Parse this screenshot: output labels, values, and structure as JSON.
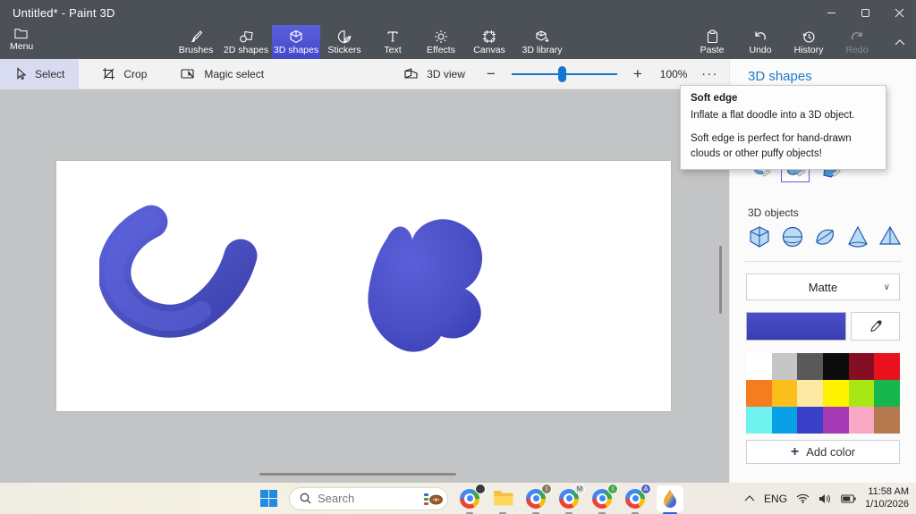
{
  "window": {
    "title": "Untitled* - Paint 3D"
  },
  "ribbon": {
    "menu_label": "Menu",
    "tabs": [
      {
        "label": "Brushes"
      },
      {
        "label": "2D shapes"
      },
      {
        "label": "3D shapes",
        "active": true
      },
      {
        "label": "Stickers"
      },
      {
        "label": "Text"
      },
      {
        "label": "Effects"
      },
      {
        "label": "Canvas"
      },
      {
        "label": "3D library"
      }
    ],
    "actions": [
      {
        "label": "Paste"
      },
      {
        "label": "Undo"
      },
      {
        "label": "History"
      },
      {
        "label": "Redo",
        "disabled": true
      }
    ]
  },
  "toolbar": {
    "select_label": "Select",
    "crop_label": "Crop",
    "magic_select_label": "Magic select",
    "view3d_label": "3D view",
    "zoom_value": "100%",
    "more_label": "..."
  },
  "panel": {
    "title": "3D shapes",
    "objects_label": "3D objects",
    "material_value": "Matte",
    "add_color_label": "Add color",
    "add_color_plus": "+",
    "current_color": "#4b4fc9",
    "current_color_dark": "#3a3db0",
    "palette": [
      "#ffffff",
      "#c6c6c6",
      "#595959",
      "#0c0c0c",
      "#850e22",
      "#e8121d",
      "#f57d20",
      "#fcbe1c",
      "#fce9a4",
      "#fef200",
      "#a8e616",
      "#17b54d",
      "#70f3ee",
      "#0aa0e8",
      "#3a41c8",
      "#a53ab4",
      "#f9a8c5",
      "#b5794f"
    ]
  },
  "tooltip": {
    "title": "Soft edge",
    "line1": "Inflate a flat doodle into a 3D object.",
    "line2": "Soft edge is perfect for hand-drawn clouds or other puffy objects!"
  },
  "canvas": {
    "shape_color": "#4b50c8",
    "shape_color_dark": "#383db0"
  },
  "taskbar": {
    "search_placeholder": "Search",
    "language": "ENG",
    "time": "11:58 AM",
    "date": "1/10/2026",
    "apps": [
      {
        "name": "chrome",
        "badge": ""
      },
      {
        "name": "folder",
        "badge": ""
      },
      {
        "name": "chrome",
        "badge": "I",
        "badge_color": "#8a7a5f"
      },
      {
        "name": "chrome",
        "badge": "M",
        "badge_color": "#d8d8d8"
      },
      {
        "name": "chrome",
        "badge": "I",
        "badge_color": "#4ca64c"
      },
      {
        "name": "chrome",
        "badge": "A",
        "badge_color": "#5b5fc7"
      },
      {
        "name": "paint3d",
        "active": true
      }
    ]
  }
}
